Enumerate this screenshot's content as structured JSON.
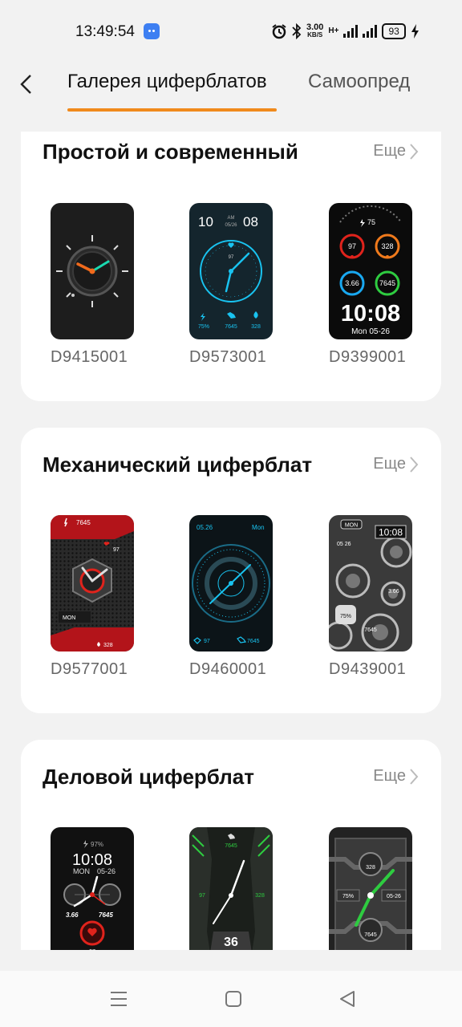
{
  "status_bar": {
    "time": "13:49:54",
    "speed_value": "3.00",
    "speed_unit": "KB/S",
    "network_type": "H+",
    "battery": "93"
  },
  "header": {
    "tabs": [
      {
        "label": "Галерея циферблатов"
      },
      {
        "label": "Самоопред"
      }
    ]
  },
  "sections": [
    {
      "title": "Простой и современный",
      "more_label": "Еще",
      "faces": [
        {
          "id": "D9415001"
        },
        {
          "id": "D9573001",
          "time_h": "10",
          "time_m": "08",
          "ampm": "AM",
          "date": "05/26",
          "hr": "97",
          "s1": "75%",
          "s2": "7645",
          "s3": "328"
        },
        {
          "id": "D9399001",
          "battery": "75",
          "hr": "97",
          "kcal": "328",
          "dist": "3.66",
          "steps": "7645",
          "time": "10:08",
          "date": "Mon 05-26"
        }
      ]
    },
    {
      "title": "Механический циферблат",
      "more_label": "Еще",
      "faces": [
        {
          "id": "D9577001",
          "steps": "7645",
          "hr": "97",
          "day": "MON",
          "kcal": "328"
        },
        {
          "id": "D9460001",
          "date": "05.26",
          "day": "Mon",
          "hr": "97",
          "steps": "7645"
        },
        {
          "id": "D9439001",
          "day": "MON",
          "time": "10:08",
          "date": "05 26",
          "dist": "3.66",
          "pct": "75%",
          "steps": "7645"
        }
      ]
    },
    {
      "title": "Деловой циферблат",
      "more_label": "Еще",
      "faces": [
        {
          "id": "",
          "battery": "97%",
          "time": "10:08",
          "day": "MON",
          "date": "05-26",
          "dist": "3.66",
          "steps": "7645",
          "hr": "97"
        },
        {
          "id": "",
          "steps": "7645",
          "hr": "97",
          "kcal": "328",
          "num": "36"
        },
        {
          "id": "",
          "kcal": "328",
          "pct": "75%",
          "date": "05-26",
          "steps": "7645"
        }
      ]
    }
  ],
  "colors": {
    "accent": "#f08a1c",
    "cyan": "#19c3f0",
    "red": "#e0231c",
    "green": "#2ecc40"
  }
}
